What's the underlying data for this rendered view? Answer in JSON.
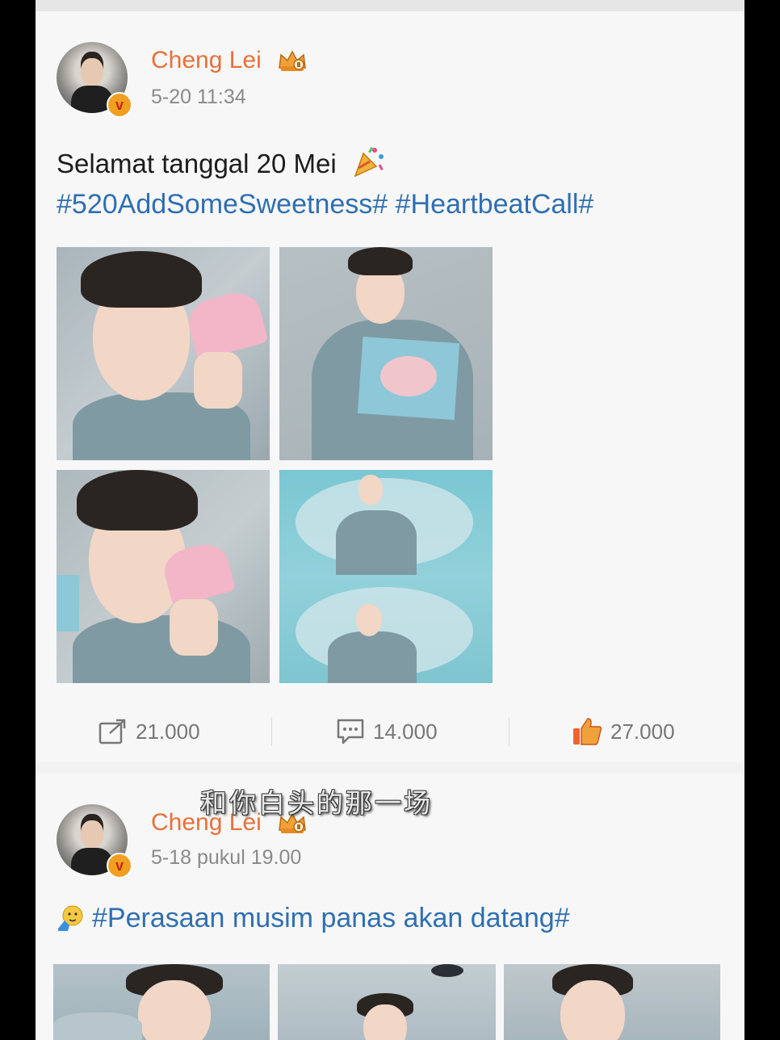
{
  "colors": {
    "username": "#e8703a",
    "hashtag": "#2f6fb1",
    "muted": "#8a8a8a",
    "like": "#f0642d"
  },
  "posts": [
    {
      "username": "Cheng Lei",
      "timestamp": "5-20 11:34",
      "text": "Selamat tanggal 20 Mei",
      "text_emoji": "party-popper-icon",
      "hashtags": "#520AddSomeSweetness# #HeartbeatCall#",
      "images": [
        "photo",
        "photo",
        "photo",
        "photo"
      ],
      "actions": {
        "repost": "21.000",
        "comment": "14.000",
        "like": "27.000"
      }
    },
    {
      "username": "Cheng Lei",
      "timestamp": "5-18 pukul 19.00",
      "hashtags": "#Perasaan musim panas akan datang#",
      "text_emoji": "salute-face-icon",
      "images": [
        "photo",
        "photo",
        "photo"
      ]
    }
  ],
  "overlay": {
    "subtitle": "和你白头的那一场"
  }
}
